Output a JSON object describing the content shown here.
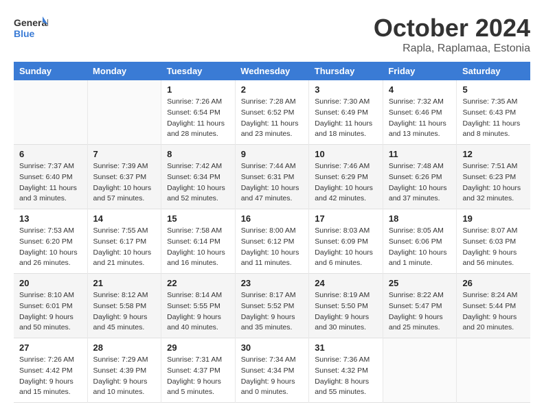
{
  "logo": {
    "line1": "General",
    "line2": "Blue"
  },
  "title": "October 2024",
  "subtitle": "Rapla, Raplamaa, Estonia",
  "header_days": [
    "Sunday",
    "Monday",
    "Tuesday",
    "Wednesday",
    "Thursday",
    "Friday",
    "Saturday"
  ],
  "weeks": [
    [
      {
        "day": "",
        "info": ""
      },
      {
        "day": "",
        "info": ""
      },
      {
        "day": "1",
        "info": "Sunrise: 7:26 AM\nSunset: 6:54 PM\nDaylight: 11 hours\nand 28 minutes."
      },
      {
        "day": "2",
        "info": "Sunrise: 7:28 AM\nSunset: 6:52 PM\nDaylight: 11 hours\nand 23 minutes."
      },
      {
        "day": "3",
        "info": "Sunrise: 7:30 AM\nSunset: 6:49 PM\nDaylight: 11 hours\nand 18 minutes."
      },
      {
        "day": "4",
        "info": "Sunrise: 7:32 AM\nSunset: 6:46 PM\nDaylight: 11 hours\nand 13 minutes."
      },
      {
        "day": "5",
        "info": "Sunrise: 7:35 AM\nSunset: 6:43 PM\nDaylight: 11 hours\nand 8 minutes."
      }
    ],
    [
      {
        "day": "6",
        "info": "Sunrise: 7:37 AM\nSunset: 6:40 PM\nDaylight: 11 hours\nand 3 minutes."
      },
      {
        "day": "7",
        "info": "Sunrise: 7:39 AM\nSunset: 6:37 PM\nDaylight: 10 hours\nand 57 minutes."
      },
      {
        "day": "8",
        "info": "Sunrise: 7:42 AM\nSunset: 6:34 PM\nDaylight: 10 hours\nand 52 minutes."
      },
      {
        "day": "9",
        "info": "Sunrise: 7:44 AM\nSunset: 6:31 PM\nDaylight: 10 hours\nand 47 minutes."
      },
      {
        "day": "10",
        "info": "Sunrise: 7:46 AM\nSunset: 6:29 PM\nDaylight: 10 hours\nand 42 minutes."
      },
      {
        "day": "11",
        "info": "Sunrise: 7:48 AM\nSunset: 6:26 PM\nDaylight: 10 hours\nand 37 minutes."
      },
      {
        "day": "12",
        "info": "Sunrise: 7:51 AM\nSunset: 6:23 PM\nDaylight: 10 hours\nand 32 minutes."
      }
    ],
    [
      {
        "day": "13",
        "info": "Sunrise: 7:53 AM\nSunset: 6:20 PM\nDaylight: 10 hours\nand 26 minutes."
      },
      {
        "day": "14",
        "info": "Sunrise: 7:55 AM\nSunset: 6:17 PM\nDaylight: 10 hours\nand 21 minutes."
      },
      {
        "day": "15",
        "info": "Sunrise: 7:58 AM\nSunset: 6:14 PM\nDaylight: 10 hours\nand 16 minutes."
      },
      {
        "day": "16",
        "info": "Sunrise: 8:00 AM\nSunset: 6:12 PM\nDaylight: 10 hours\nand 11 minutes."
      },
      {
        "day": "17",
        "info": "Sunrise: 8:03 AM\nSunset: 6:09 PM\nDaylight: 10 hours\nand 6 minutes."
      },
      {
        "day": "18",
        "info": "Sunrise: 8:05 AM\nSunset: 6:06 PM\nDaylight: 10 hours\nand 1 minute."
      },
      {
        "day": "19",
        "info": "Sunrise: 8:07 AM\nSunset: 6:03 PM\nDaylight: 9 hours\nand 56 minutes."
      }
    ],
    [
      {
        "day": "20",
        "info": "Sunrise: 8:10 AM\nSunset: 6:01 PM\nDaylight: 9 hours\nand 50 minutes."
      },
      {
        "day": "21",
        "info": "Sunrise: 8:12 AM\nSunset: 5:58 PM\nDaylight: 9 hours\nand 45 minutes."
      },
      {
        "day": "22",
        "info": "Sunrise: 8:14 AM\nSunset: 5:55 PM\nDaylight: 9 hours\nand 40 minutes."
      },
      {
        "day": "23",
        "info": "Sunrise: 8:17 AM\nSunset: 5:52 PM\nDaylight: 9 hours\nand 35 minutes."
      },
      {
        "day": "24",
        "info": "Sunrise: 8:19 AM\nSunset: 5:50 PM\nDaylight: 9 hours\nand 30 minutes."
      },
      {
        "day": "25",
        "info": "Sunrise: 8:22 AM\nSunset: 5:47 PM\nDaylight: 9 hours\nand 25 minutes."
      },
      {
        "day": "26",
        "info": "Sunrise: 8:24 AM\nSunset: 5:44 PM\nDaylight: 9 hours\nand 20 minutes."
      }
    ],
    [
      {
        "day": "27",
        "info": "Sunrise: 7:26 AM\nSunset: 4:42 PM\nDaylight: 9 hours\nand 15 minutes."
      },
      {
        "day": "28",
        "info": "Sunrise: 7:29 AM\nSunset: 4:39 PM\nDaylight: 9 hours\nand 10 minutes."
      },
      {
        "day": "29",
        "info": "Sunrise: 7:31 AM\nSunset: 4:37 PM\nDaylight: 9 hours\nand 5 minutes."
      },
      {
        "day": "30",
        "info": "Sunrise: 7:34 AM\nSunset: 4:34 PM\nDaylight: 9 hours\nand 0 minutes."
      },
      {
        "day": "31",
        "info": "Sunrise: 7:36 AM\nSunset: 4:32 PM\nDaylight: 8 hours\nand 55 minutes."
      },
      {
        "day": "",
        "info": ""
      },
      {
        "day": "",
        "info": ""
      }
    ]
  ]
}
